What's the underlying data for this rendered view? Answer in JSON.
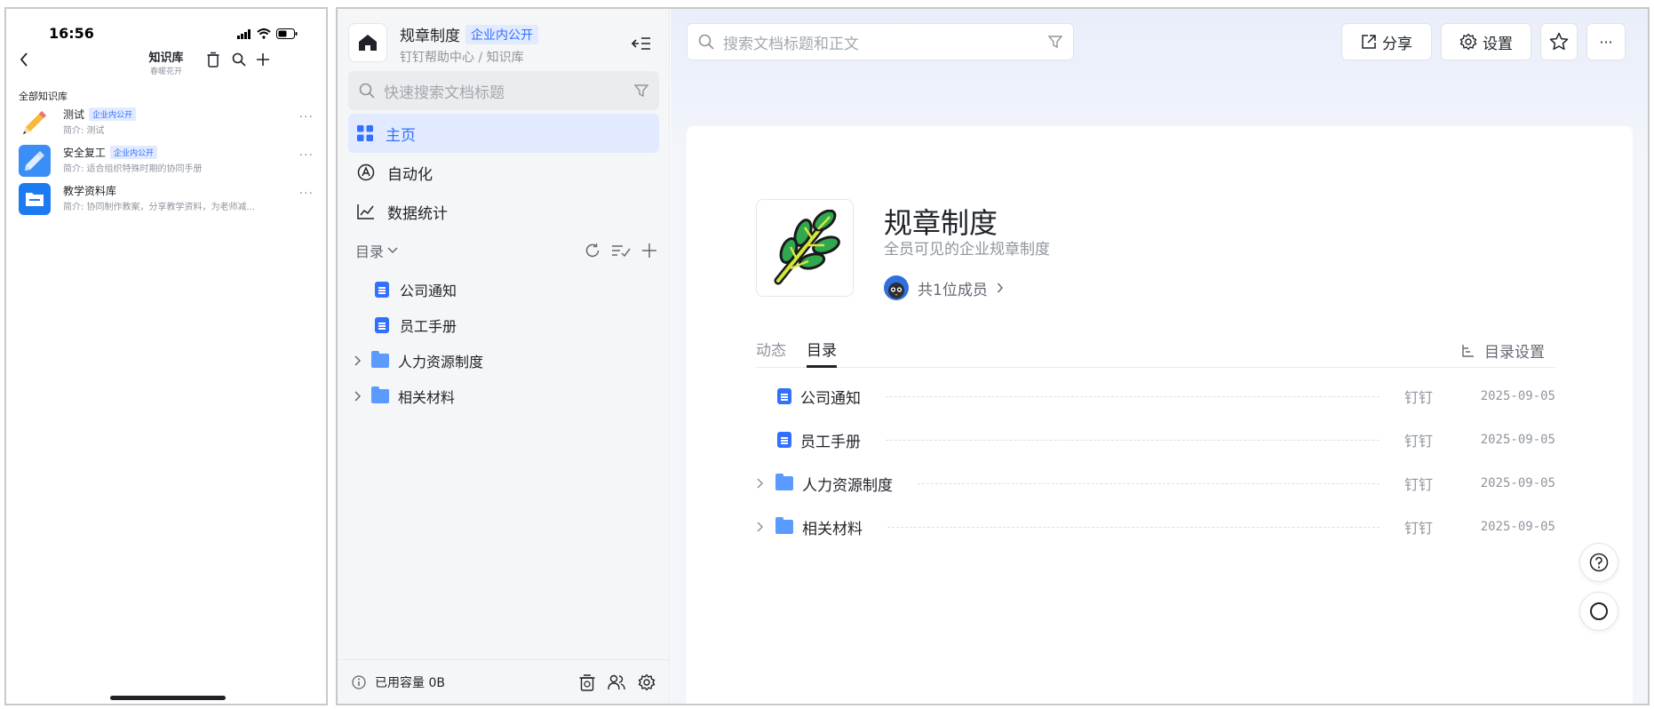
{
  "phone": {
    "status": {
      "time": "16:56"
    },
    "header": {
      "title": "知识库",
      "subtitle": "春暖花开"
    },
    "section_label": "全部知识库",
    "items": [
      {
        "name": "测试",
        "tag": "企业内公开",
        "desc": "简介: 测试"
      },
      {
        "name": "安全复工",
        "tag": "企业内公开",
        "desc": "简介: 适合组织特殊时期的协同手册"
      },
      {
        "name": "教学资料库",
        "tag": "",
        "desc": "简介: 协同制作教案，分享教学资料，为老师减..."
      }
    ],
    "more": "···"
  },
  "sidebar": {
    "title": "规章制度",
    "tag": "企业内公开",
    "breadcrumb": "钉钉帮助中心 / 知识库",
    "search_placeholder": "快速搜索文档标题",
    "nav": [
      {
        "label": "主页"
      },
      {
        "label": "自动化"
      },
      {
        "label": "数据统计"
      }
    ],
    "toc_label": "目录",
    "tree": [
      {
        "label": "公司通知",
        "type": "doc"
      },
      {
        "label": "员工手册",
        "type": "doc"
      },
      {
        "label": "人力资源制度",
        "type": "folder"
      },
      {
        "label": "相关材料",
        "type": "folder"
      }
    ],
    "footer": {
      "storage": "已用容量 0B"
    }
  },
  "main": {
    "search_placeholder": "搜索文档标题和正文",
    "buttons": {
      "share": "分享",
      "settings": "设置"
    },
    "more": "···",
    "kb": {
      "title": "规章制度",
      "subtitle": "全员可见的企业规章制度",
      "members": "共1位成员"
    },
    "tabs": [
      {
        "label": "动态"
      },
      {
        "label": "目录"
      }
    ],
    "toc_settings": "目录设置",
    "rows": [
      {
        "label": "公司通知",
        "type": "doc",
        "source": "钉钉",
        "date": "2025-09-05"
      },
      {
        "label": "员工手册",
        "type": "doc",
        "source": "钉钉",
        "date": "2025-09-05"
      },
      {
        "label": "人力资源制度",
        "type": "folder",
        "source": "钉钉",
        "date": "2025-09-05"
      },
      {
        "label": "相关材料",
        "type": "folder",
        "source": "钉钉",
        "date": "2025-09-05"
      }
    ]
  },
  "colors": {
    "accent": "#3370ff",
    "accent_bg": "#e1eaff",
    "muted": "#8f959e"
  }
}
